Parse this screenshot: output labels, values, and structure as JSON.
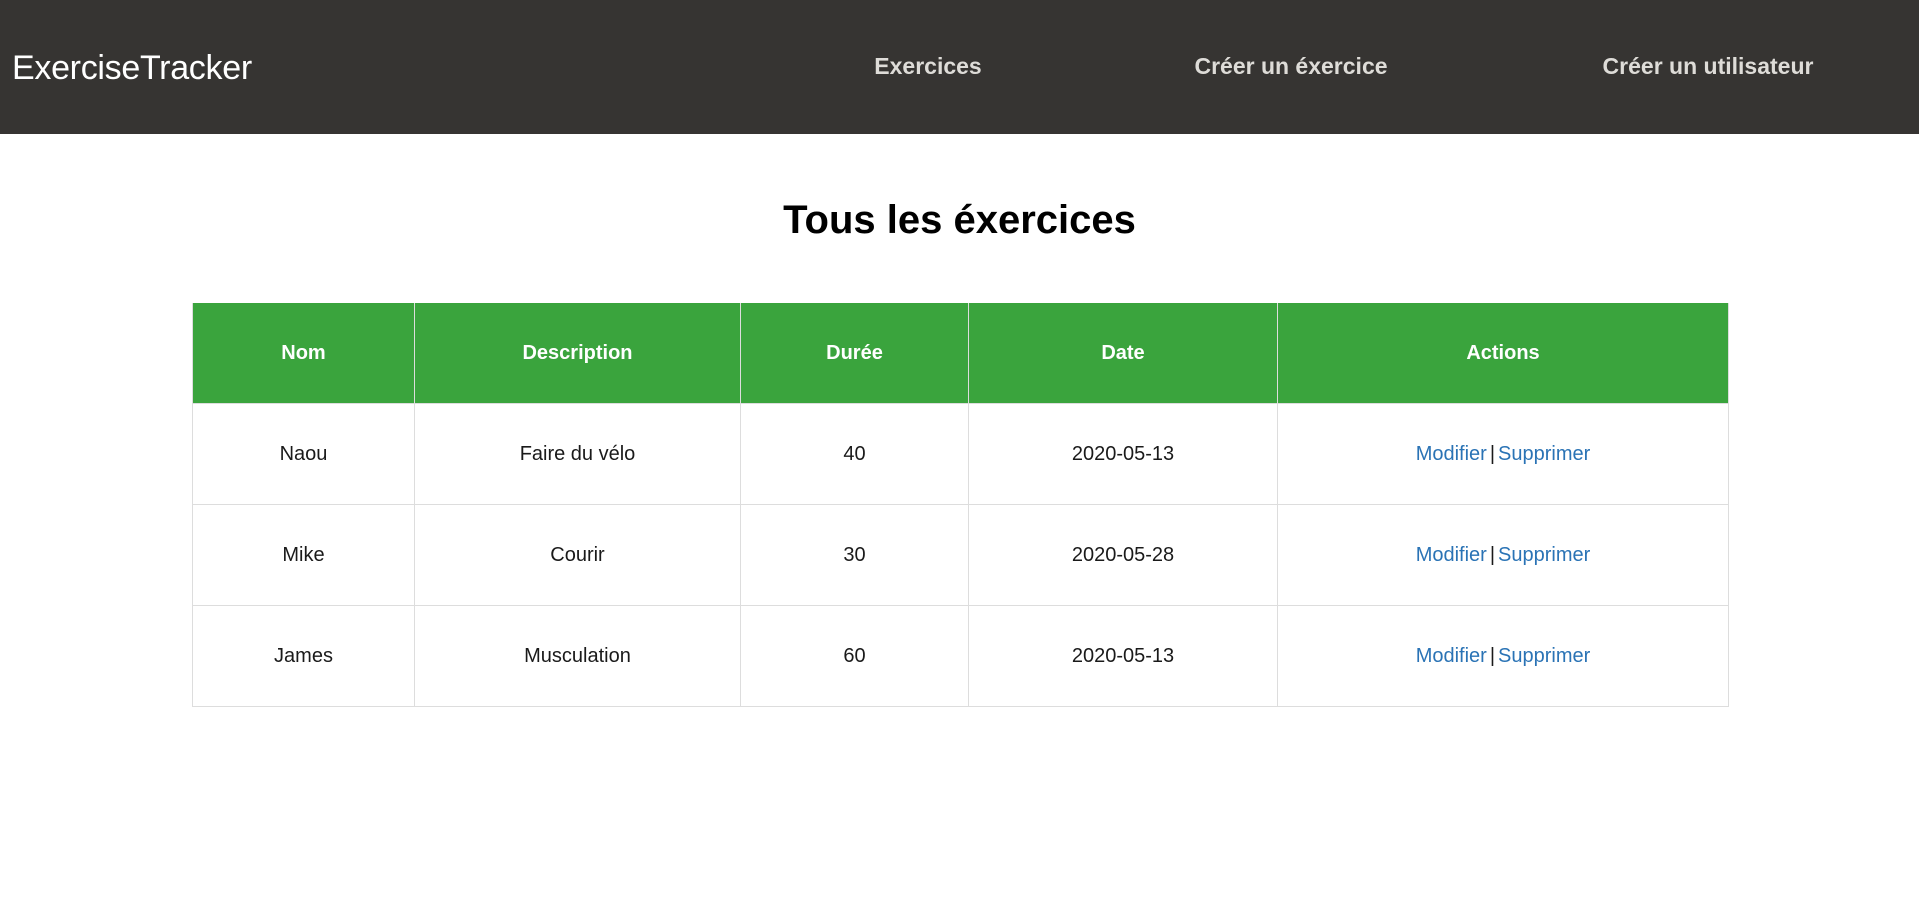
{
  "navbar": {
    "brand": "ExerciseTracker",
    "links": [
      {
        "label": "Exercices"
      },
      {
        "label": "Créer un éxercice"
      },
      {
        "label": "Créer un utilisateur"
      }
    ]
  },
  "main": {
    "title": "Tous les éxercices",
    "table": {
      "headers": [
        "Nom",
        "Description",
        "Durée",
        "Date",
        "Actions"
      ],
      "rows": [
        {
          "nom": "Naou",
          "description": "Faire du vélo",
          "duree": "40",
          "date": "2020-05-13"
        },
        {
          "nom": "Mike",
          "description": "Courir",
          "duree": "30",
          "date": "2020-05-28"
        },
        {
          "nom": "James",
          "description": "Musculation",
          "duree": "60",
          "date": "2020-05-13"
        }
      ],
      "actions": {
        "edit": "Modifier",
        "separator": "|",
        "delete": "Supprimer"
      }
    }
  },
  "colors": {
    "navbar_bg": "#363432",
    "header_bg": "#3aa43d",
    "link": "#2a73b5"
  }
}
